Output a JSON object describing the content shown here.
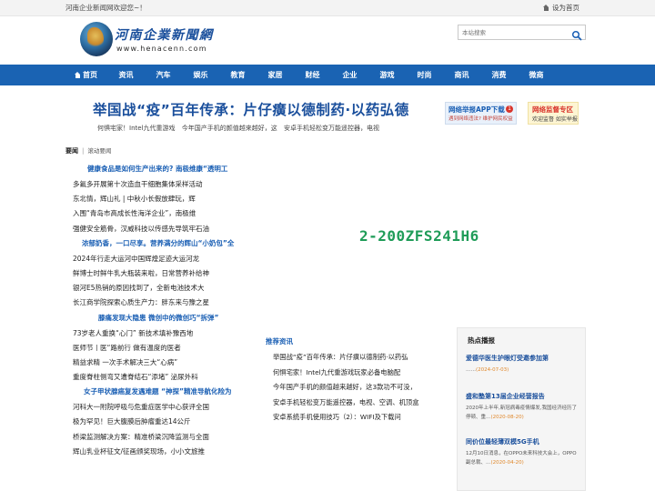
{
  "topbar": {
    "welcome": "河南企业新闻网欢迎您~！",
    "set_home": "设为首页"
  },
  "logo": {
    "name_cn": "河南企業新聞網",
    "url": "www.henacenn.com"
  },
  "search": {
    "placeholder": "本站搜索",
    "icon": "search-icon"
  },
  "nav": {
    "items": [
      "首页",
      "资讯",
      "汽车",
      "娱乐",
      "教育",
      "家居",
      "财经",
      "企业",
      "游戏",
      "时尚",
      "商讯",
      "消费",
      "微商"
    ]
  },
  "headline": {
    "title": "举国战“疫”百年传承：片仔癀以德制药·以药弘德",
    "sub": [
      "何惧宅家！Intel九代重游戏",
      "今年国产手机的颜值越来越好，这",
      "安卓手机轻松变万能遥控器，电视"
    ]
  },
  "badges": {
    "report": {
      "title": "网络举报APP下载",
      "sub": "遇到网络违法? 维护网民权益",
      "dot": "1"
    },
    "supervise": {
      "title": "网络监督专区",
      "sub": "欢迎监督  如实举报"
    }
  },
  "tabs": {
    "main": "要闻",
    "sub": "滚动要闻"
  },
  "left_sections": [
    {
      "title": "健康食品是如何生产出来的? 南极维康“透明工",
      "items": [
        "多氟多开展第十次造血干细胞集体采样活动",
        "东北情，辉山礼 | 中秋小长假放肆玩，辉",
        "入围“青岛市高成长性海洋企业”，南极维",
        "强健安全筋骨，汉威科技以传感先导筑牢石油"
      ]
    },
    {
      "title": "浓郁奶香，一口尽享。营养满分的辉山“小奶包”全",
      "items": [
        "2024年行走大运河中国辉煌足迹大运河龙",
        "鲜博士时鲜牛乳大瓶装来啦，日常营养补给神",
        "银河E5热销的原因找到了，全新电池技术大",
        "长江商学院探索心质生产力：胖东来与豫之星"
      ]
    },
    {
      "title": "膝痛发现大隐患 微创中的微创巧“拆弹”",
      "items": [
        "73岁老人重换“心门” 新技术填补豫西地",
        "医师节丨医“路前行 做有温度的医者",
        "精益求精 一次手术解决三大“心病”",
        "重度脊柱侧弯又遭脊结石“添堵” 泌尿外科"
      ]
    },
    {
      "title": "女子甲状腺癌复发遇难题 “神探”精准导航化险为",
      "items": [
        "河科大一附院呼吸与危重症医学中心获评全国",
        "极为罕见！巨大腹膜后肿瘤重达14公斤",
        "桥梁监测解决方案：精准桥梁沉降监测与全面",
        "辉山乳业杯征文/征画颁奖现场，小小文旅推"
      ]
    }
  ],
  "promo": {
    "code": "2-200ZFS241H6"
  },
  "recommend": {
    "title": "推荐资讯",
    "items": [
      "举国战“疫”百年传承：片仔癀以德制药·以药弘",
      "何惧宅家！Intel九代重游戏玩家必备电脑配",
      "今年国产手机的颜值越来越好，这3款功不可没，",
      "安卓手机轻松变万能遥控器，电视、空调、机顶盒",
      "安卓系统手机使用技巧（2）：WIFI及下载问"
    ]
  },
  "hot": {
    "title": "热点播报",
    "items": [
      {
        "title": "爱德华医生护眼灯受邀参加第",
        "body": "……",
        "date": "(2024-07-03)"
      },
      {
        "title": "盛和塾第13届企业经营报告",
        "body": "2020年上半年,新冠病毒疫情爆发,我国经济经历了停顿、重…",
        "date": "(2020-08-20)"
      },
      {
        "title": "同价位最轻薄双模5G手机",
        "body": "12月10日消息，在OPPO未来科技大会上，OPPO副总裁、…",
        "date": "(2020-04-20)"
      }
    ]
  },
  "colors": {
    "brand_blue": "#1a63b3",
    "link_blue": "#1a5fb4",
    "promo_green": "#1f9c58",
    "alert_red": "#d9342b",
    "date_orange": "#e0872a"
  }
}
